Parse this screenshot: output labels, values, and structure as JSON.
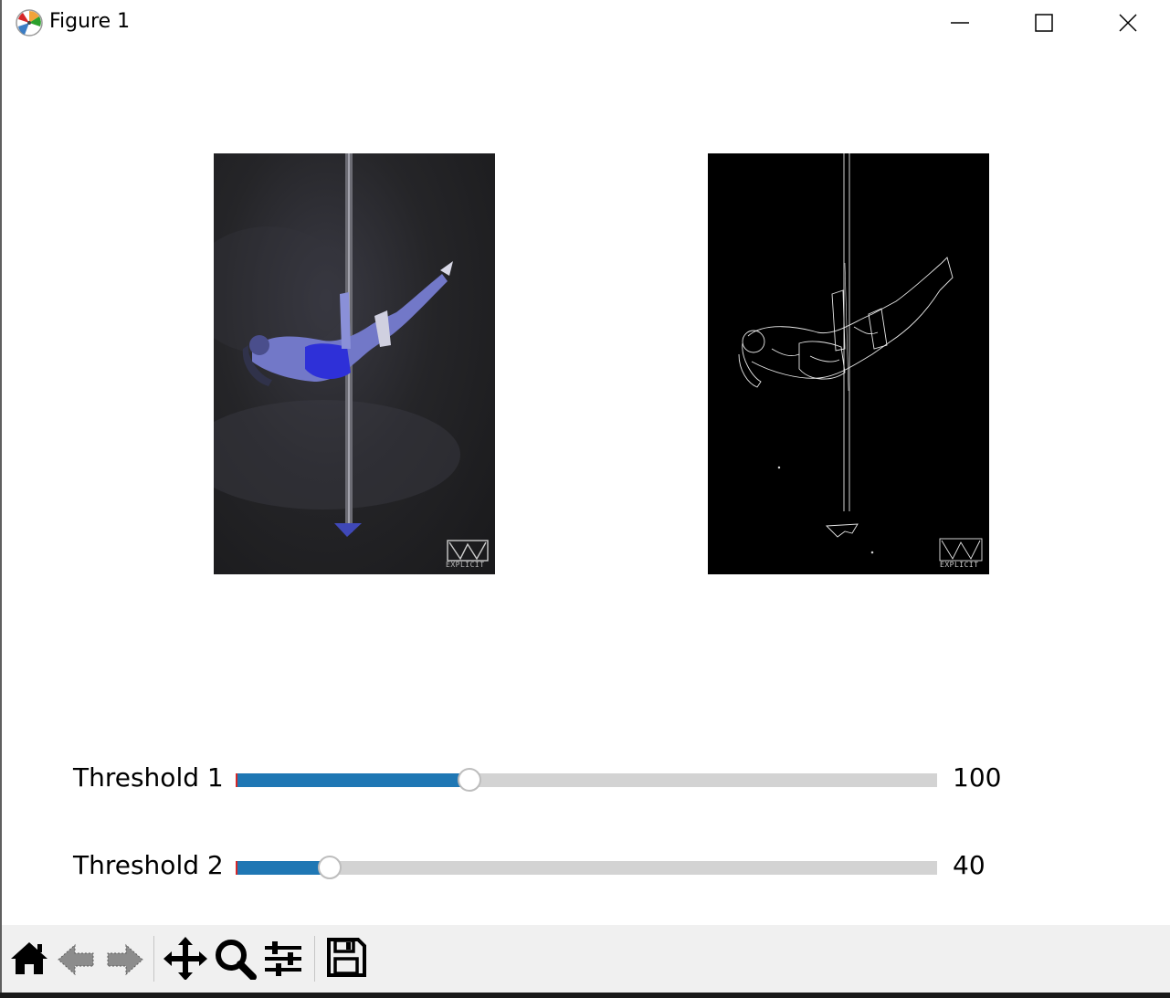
{
  "window": {
    "title": "Figure 1",
    "controls": [
      "minimize",
      "maximize",
      "close"
    ]
  },
  "images": [
    {
      "name": "original-image",
      "watermark": "EXPLICIT"
    },
    {
      "name": "edge-image",
      "watermark": "EXPLICIT"
    }
  ],
  "sliders": [
    {
      "label": "Threshold 1",
      "value": "100",
      "fraction": 0.333
    },
    {
      "label": "Threshold 2",
      "value": "40",
      "fraction": 0.133
    }
  ],
  "toolbar": {
    "tools": [
      "home-icon",
      "back-icon",
      "forward-icon",
      "pan-icon",
      "zoom-icon",
      "configure-subplots-icon",
      "save-icon"
    ]
  },
  "colors": {
    "slider_fill": "#1f77b4",
    "slider_track": "#d3d3d3",
    "slider_init": "#d62728",
    "toolbar_bg": "#f0f0f0"
  }
}
